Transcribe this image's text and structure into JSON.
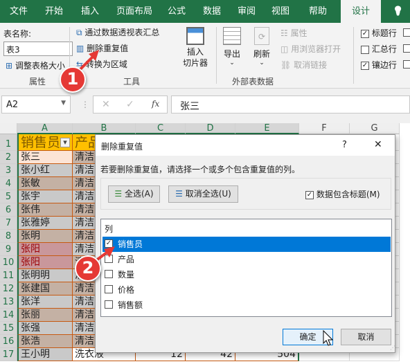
{
  "tabs": [
    "文件",
    "开始",
    "插入",
    "页面布局",
    "公式",
    "数据",
    "审阅",
    "视图",
    "帮助",
    "设计"
  ],
  "active_tab": "设计",
  "ribbon": {
    "table_name_label": "表名称:",
    "table_name_value": "表3",
    "resize_label": "调整表格大小",
    "group_properties": "属性",
    "pivot_label": "通过数据透视表汇总",
    "remove_dup_label": "删除重复值",
    "convert_label": "转换为区域",
    "slicer_label": "插入\n切片器",
    "group_tools": "工具",
    "export_label": "导出",
    "refresh_label": "刷新",
    "props_label": "属性",
    "open_browser_label": "用浏览器打开",
    "unlink_label": "取消链接",
    "group_external": "外部表数据",
    "header_row_label": "标题行",
    "total_row_label": "汇总行",
    "banded_rows_label": "镶边行",
    "header_row_checked": true,
    "total_row_checked": false,
    "banded_rows_checked": true
  },
  "formula_bar": {
    "name_box": "A2",
    "fx": "fx",
    "value": "张三"
  },
  "columns": [
    "A",
    "B",
    "C",
    "D",
    "E",
    "F",
    "G"
  ],
  "table": {
    "header": [
      "销售员",
      "产品"
    ],
    "rows": [
      {
        "n": "2",
        "a": "张三",
        "b": "清洁"
      },
      {
        "n": "3",
        "a": "张小红",
        "b": "清洁"
      },
      {
        "n": "4",
        "a": "张敏",
        "b": "清洁"
      },
      {
        "n": "5",
        "a": "张宇",
        "b": "清洁"
      },
      {
        "n": "6",
        "a": "张伟",
        "b": "清洁"
      },
      {
        "n": "7",
        "a": "张雅婷",
        "b": "清洁"
      },
      {
        "n": "8",
        "a": "张明",
        "b": "清洁"
      },
      {
        "n": "9",
        "a": "张阳",
        "b": "清洁"
      },
      {
        "n": "10",
        "a": "张阳",
        "b": "清"
      },
      {
        "n": "11",
        "a": "张明明",
        "b": "清"
      },
      {
        "n": "12",
        "a": "张建国",
        "b": "清洁"
      },
      {
        "n": "13",
        "a": "张洋",
        "b": "清洁"
      },
      {
        "n": "14",
        "a": "张丽",
        "b": "清洁"
      },
      {
        "n": "15",
        "a": "张强",
        "b": "清洁"
      },
      {
        "n": "16",
        "a": "张浩",
        "b": "清洁"
      },
      {
        "n": "17",
        "a": "王小明",
        "b": "洗衣液",
        "c": "12",
        "d": "42",
        "e": "504"
      }
    ]
  },
  "dialog": {
    "title": "删除重复值",
    "help": "?",
    "close": "✕",
    "instruction": "若要删除重复值，请选择一个或多个包含重复值的列。",
    "select_all": "全选(A)",
    "unselect_all": "取消全选(U)",
    "has_headers_label": "数据包含标题(M)",
    "has_headers_checked": true,
    "list_header": "列",
    "columns": [
      {
        "label": "销售员",
        "checked": true
      },
      {
        "label": "产品",
        "checked": false
      },
      {
        "label": "数量",
        "checked": false
      },
      {
        "label": "价格",
        "checked": false
      },
      {
        "label": "销售额",
        "checked": false
      }
    ],
    "ok": "确定",
    "cancel": "取消"
  },
  "annotations": [
    "1",
    "2"
  ],
  "colors": {
    "excel_green": "#217346",
    "table_header": "#ffc000",
    "table_border": "#c65911",
    "selection": "#0078d7",
    "badge": "#e53935"
  }
}
